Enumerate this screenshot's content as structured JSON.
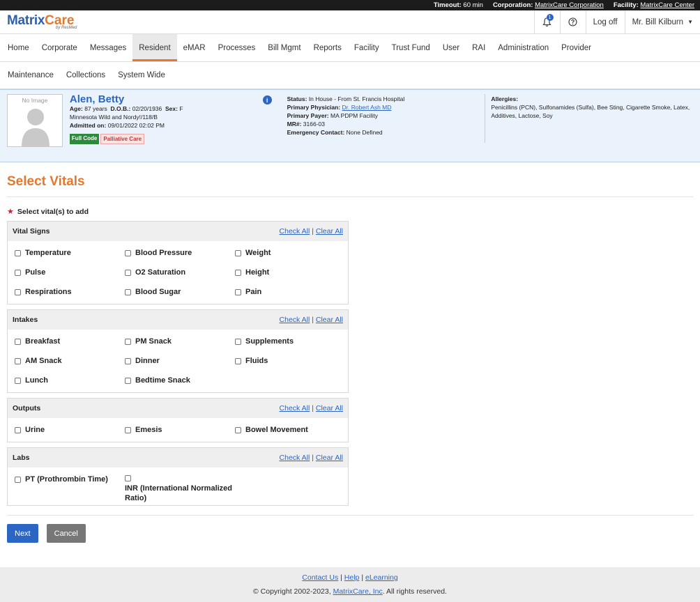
{
  "topbar": {
    "timeout_label": "Timeout:",
    "timeout_value": "60 min",
    "corporation_label": "Corporation:",
    "corporation_value": "MatrixCare Corporation",
    "facility_label": "Facility:",
    "facility_value": "MatrixCare Center"
  },
  "header": {
    "logo_main": "Matrix",
    "logo_accent": "Care",
    "logo_sub": "by ResMed",
    "notification_count": "1",
    "logoff_label": "Log off",
    "user_name": "Mr. Bill Kilburn"
  },
  "nav": {
    "row1": [
      "Home",
      "Corporate",
      "Messages",
      "Resident",
      "eMAR",
      "Processes",
      "Bill Mgmt",
      "Reports",
      "Facility",
      "Trust Fund",
      "User",
      "RAI",
      "Administration",
      "Provider"
    ],
    "row2": [
      "Maintenance",
      "Collections",
      "System Wide"
    ],
    "active": "Resident"
  },
  "resident": {
    "no_image": "No Image",
    "name": "Alen, Betty",
    "age_label": "Age:",
    "age": "87 years",
    "dob_label": "D.O.B.:",
    "dob": "02/20/1936",
    "sex_label": "Sex:",
    "sex": "F",
    "location": "Minnesota Wild and Nordy!/118/B",
    "admitted_label": "Admitted on:",
    "admitted": "09/01/2022 02:02 PM",
    "tag_code": "Full Code",
    "tag_care": "Palliative Care",
    "status_label": "Status:",
    "status": "In House - From St. Francis Hospital",
    "physician_label": "Primary Physician:",
    "physician": "Dr. Robert Ash MD",
    "payer_label": "Primary Payer:",
    "payer": "MA PDPM Facility",
    "mr_label": "MR#:",
    "mr": "3166-03",
    "emergency_label": "Emergency Contact:",
    "emergency": "None Defined",
    "allergies_label": "Allergies:",
    "allergies": "Penicillins (PCN), Sulfonamides (Sulfa), Bee Sting, Cigarette Smoke, Latex, Additives, Lactose, Soy"
  },
  "page": {
    "title": "Select Vitals",
    "required_label": "Select vital(s) to add",
    "check_all": "Check All",
    "clear_all": "Clear All",
    "separator": "|"
  },
  "groups": {
    "vital_signs": {
      "title": "Vital Signs",
      "items": [
        "Temperature",
        "Blood Pressure",
        "Weight",
        "Pulse",
        "O2 Saturation",
        "Height",
        "Respirations",
        "Blood Sugar",
        "Pain"
      ]
    },
    "intakes": {
      "title": "Intakes",
      "items": [
        "Breakfast",
        "PM Snack",
        "Supplements",
        "AM Snack",
        "Dinner",
        "Fluids",
        "Lunch",
        "Bedtime Snack"
      ]
    },
    "outputs": {
      "title": "Outputs",
      "items": [
        "Urine",
        "Emesis",
        "Bowel Movement"
      ]
    },
    "labs": {
      "title": "Labs",
      "items": [
        "PT (Prothrombin Time)",
        "INR (International Normalized Ratio)"
      ]
    }
  },
  "buttons": {
    "next": "Next",
    "cancel": "Cancel"
  },
  "footer": {
    "contact": "Contact Us",
    "help": "Help",
    "elearning": "eLearning",
    "copyright_pre": "© Copyright 2002-2023,",
    "company": "MatrixCare, Inc",
    "copyright_post": ". All rights reserved."
  }
}
